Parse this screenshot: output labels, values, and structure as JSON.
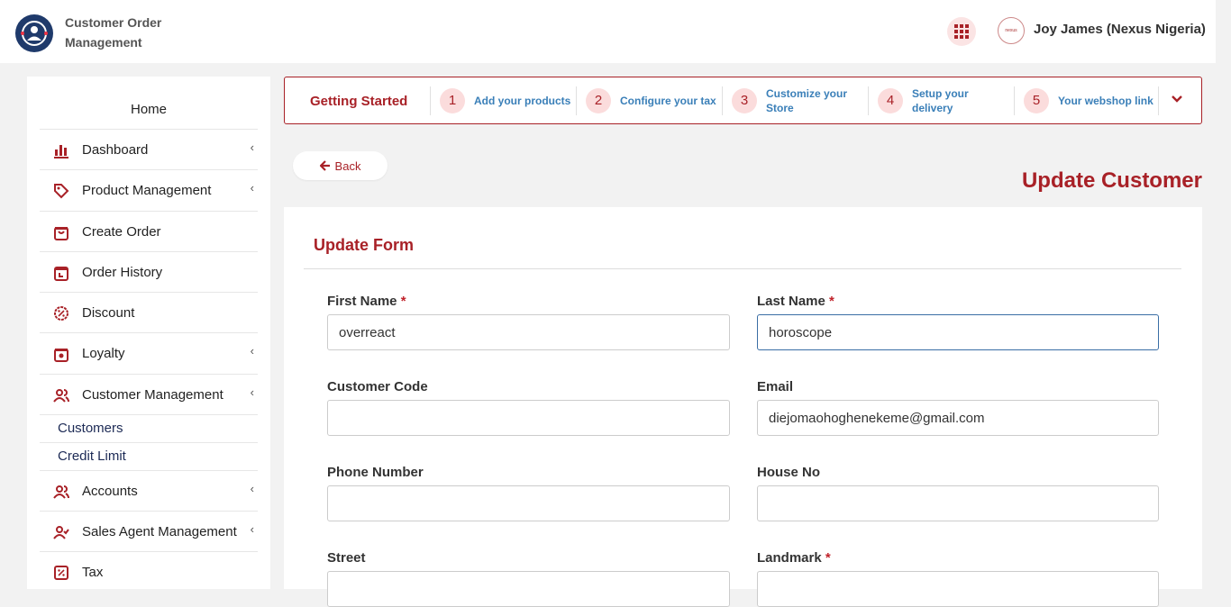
{
  "header": {
    "app_title": "Customer Order Management",
    "user_name": "Joy James (Nexus Nigeria)",
    "avatar_text": "nexus"
  },
  "sidebar": {
    "home": "Home",
    "items": [
      {
        "label": "Dashboard",
        "icon": "bar-chart-icon",
        "chevron": true
      },
      {
        "label": "Product Management",
        "icon": "tag-icon",
        "chevron": true
      },
      {
        "label": "Create Order",
        "icon": "shopping-bag-icon",
        "chevron": false
      },
      {
        "label": "Order History",
        "icon": "order-history-icon",
        "chevron": false
      },
      {
        "label": "Discount",
        "icon": "discount-icon",
        "chevron": false
      },
      {
        "label": "Loyalty",
        "icon": "gift-icon",
        "chevron": true
      },
      {
        "label": "Customer Management",
        "icon": "users-icon",
        "chevron": true
      },
      {
        "label": "Accounts",
        "icon": "users-icon",
        "chevron": true
      },
      {
        "label": "Sales Agent Management",
        "icon": "user-check-icon",
        "chevron": true
      },
      {
        "label": "Tax",
        "icon": "percent-icon",
        "chevron": false
      }
    ],
    "sub_items": [
      "Customers",
      "Credit Limit"
    ],
    "chevron_glyph": "‹"
  },
  "steps": {
    "title": "Getting Started",
    "items": [
      {
        "num": "1",
        "label": "Add your products"
      },
      {
        "num": "2",
        "label": "Configure your tax"
      },
      {
        "num": "3",
        "label": "Customize your Store"
      },
      {
        "num": "4",
        "label": "Setup your delivery"
      },
      {
        "num": "5",
        "label": "Your webshop link"
      }
    ]
  },
  "page": {
    "back_label": "Back",
    "title": "Update Customer",
    "form_title": "Update Form"
  },
  "form": {
    "first_name": {
      "label": "First Name",
      "value": "overreact",
      "required": "*"
    },
    "last_name": {
      "label": "Last Name",
      "value": "horoscope",
      "required": "*"
    },
    "customer_code": {
      "label": "Customer Code",
      "value": ""
    },
    "email": {
      "label": "Email",
      "value": "diejomaohoghenekeme@gmail.com"
    },
    "phone": {
      "label": "Phone Number",
      "value": ""
    },
    "house_no": {
      "label": "House No",
      "value": ""
    },
    "street": {
      "label": "Street",
      "value": ""
    },
    "landmark": {
      "label": "Landmark",
      "value": "",
      "required": "*"
    }
  },
  "colors": {
    "brand": "#a82127",
    "link": "#3a7fb8",
    "navy": "#1f3a6b"
  }
}
